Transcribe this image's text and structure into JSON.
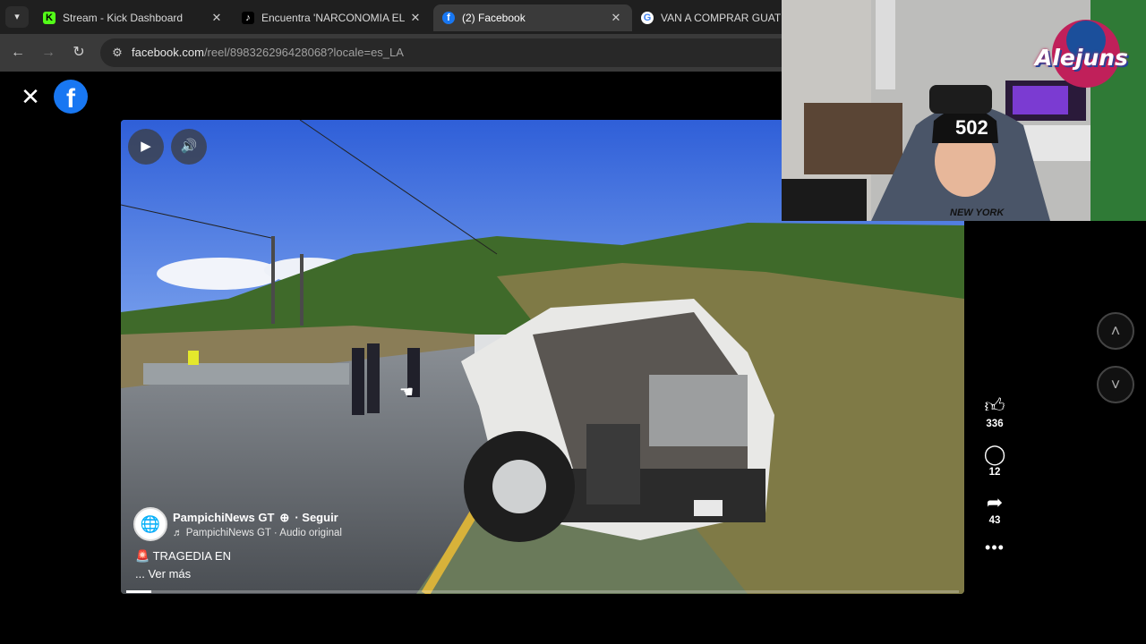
{
  "browser": {
    "tabs": [
      {
        "title": "Stream - Kick Dashboard",
        "favicon_icon": "kick-icon",
        "active": false
      },
      {
        "title": "Encuentra 'NARCONOMIA EL M",
        "favicon_icon": "tiktok-icon",
        "active": false
      },
      {
        "title": "(2) Facebook",
        "favicon_icon": "facebook-icon",
        "active": true
      },
      {
        "title": "VAN A COMPRAR GUATEMA",
        "favicon_icon": "google-icon",
        "active": false
      }
    ],
    "url_host": "facebook.com",
    "url_path": "/reel/898326296428068?locale=es_LA"
  },
  "reel": {
    "author_name": "PampichiNews GT",
    "follow_label": "Seguir",
    "audio_label": "PampichiNews GT · Audio original",
    "caption": "TRAGEDIA EN",
    "see_more": "... Ver más",
    "progress_fraction": 0.03
  },
  "actions": {
    "likes": "336",
    "comments": "12",
    "shares": "43",
    "more": "•••"
  },
  "webcam": {
    "cap_text": "502",
    "shirt_text": "NEW YORK",
    "streamer_logo": "Alejuns"
  },
  "colors": {
    "facebook_blue": "#1877f2",
    "active_tab": "#3a3a3a",
    "tabbar": "#1f1f1f"
  }
}
